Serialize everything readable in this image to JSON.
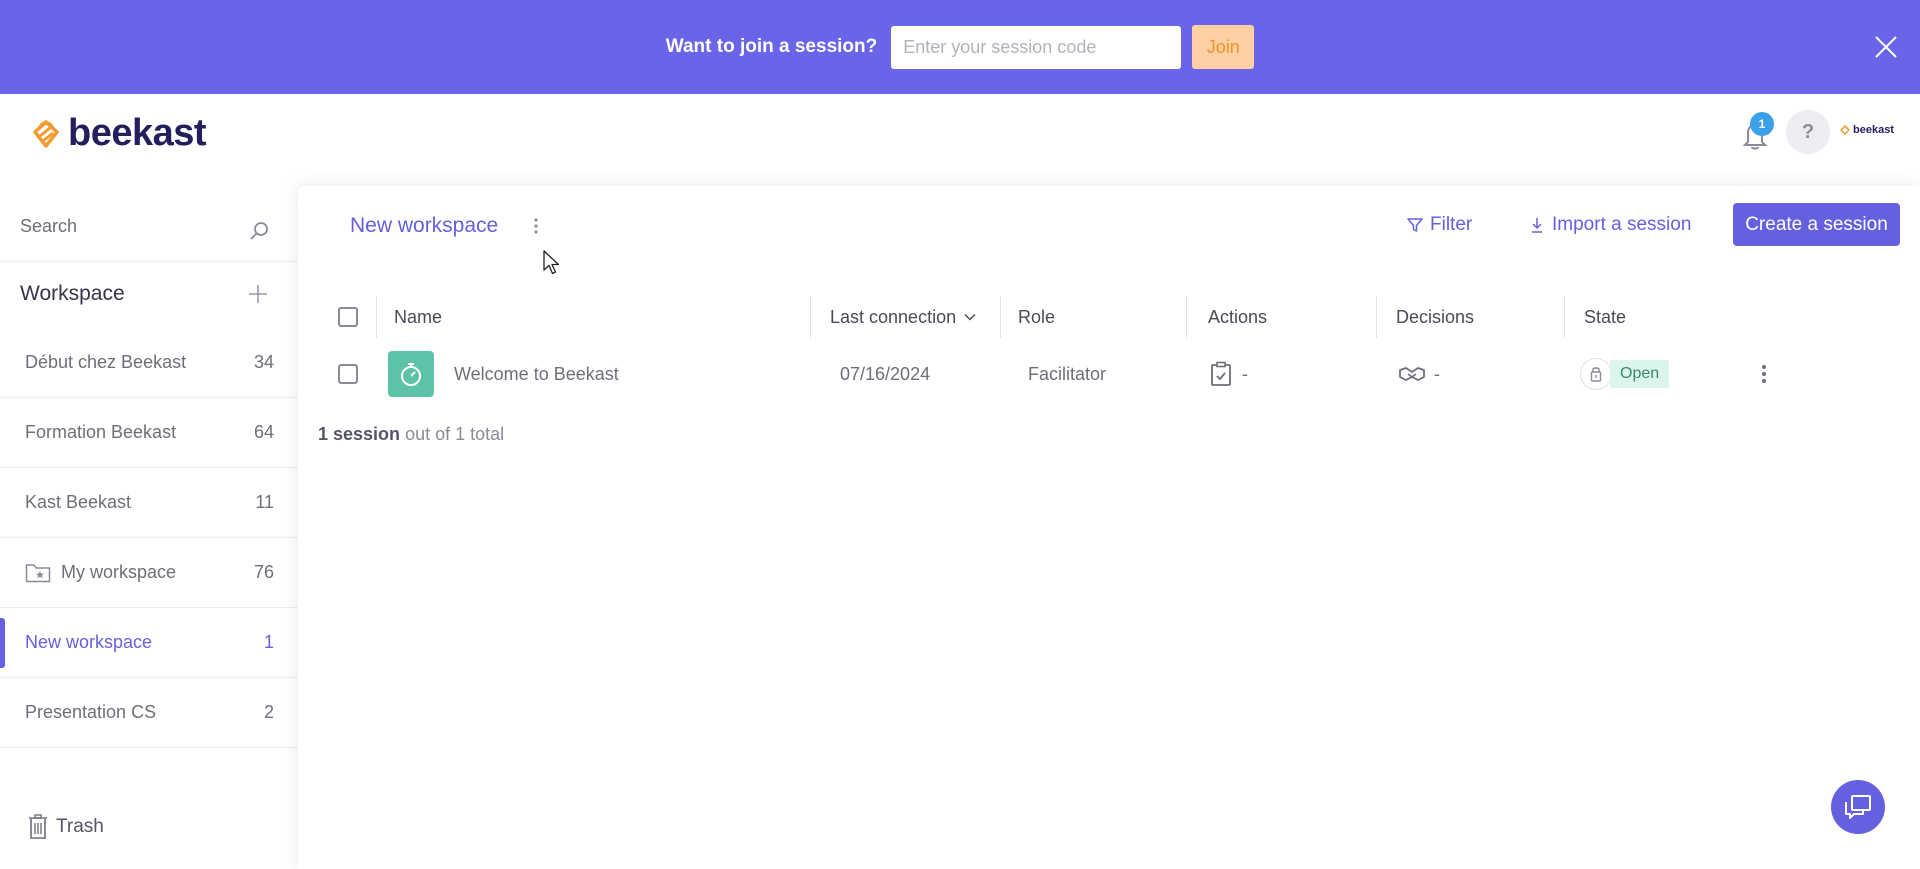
{
  "banner": {
    "prompt": "Want to join a session?",
    "input_placeholder": "Enter your session code",
    "join_label": "Join"
  },
  "header": {
    "logo_text": "beekast",
    "notification_count": "1",
    "help_label": "?",
    "account_logo_text": "beekast"
  },
  "sidebar": {
    "search_placeholder": "Search",
    "workspace_heading": "Workspace",
    "items": [
      {
        "label": "Début chez Beekast",
        "count": "34"
      },
      {
        "label": "Formation Beekast",
        "count": "64"
      },
      {
        "label": "Kast Beekast",
        "count": "11"
      },
      {
        "label": "My workspace",
        "count": "76"
      },
      {
        "label": "New workspace",
        "count": "1"
      },
      {
        "label": "Presentation CS",
        "count": "2"
      }
    ],
    "trash_label": "Trash"
  },
  "main": {
    "title": "New workspace",
    "filter_label": "Filter",
    "import_label": "Import a session",
    "create_label": "Create a session",
    "columns": {
      "name": "Name",
      "last_connection": "Last connection",
      "role": "Role",
      "actions": "Actions",
      "decisions": "Decisions",
      "state": "State"
    },
    "rows": [
      {
        "name": "Welcome to Beekast",
        "last_connection": "07/16/2024",
        "role": "Facilitator",
        "actions": "-",
        "decisions": "-",
        "state": "Open"
      }
    ],
    "summary_count": "1 session",
    "summary_rest": "out of 1 total"
  },
  "colors": {
    "banner": "#6964e8",
    "accent": "#6560e0",
    "join_bg": "#ffd0a3",
    "session_icon": "#5cc3a8"
  }
}
